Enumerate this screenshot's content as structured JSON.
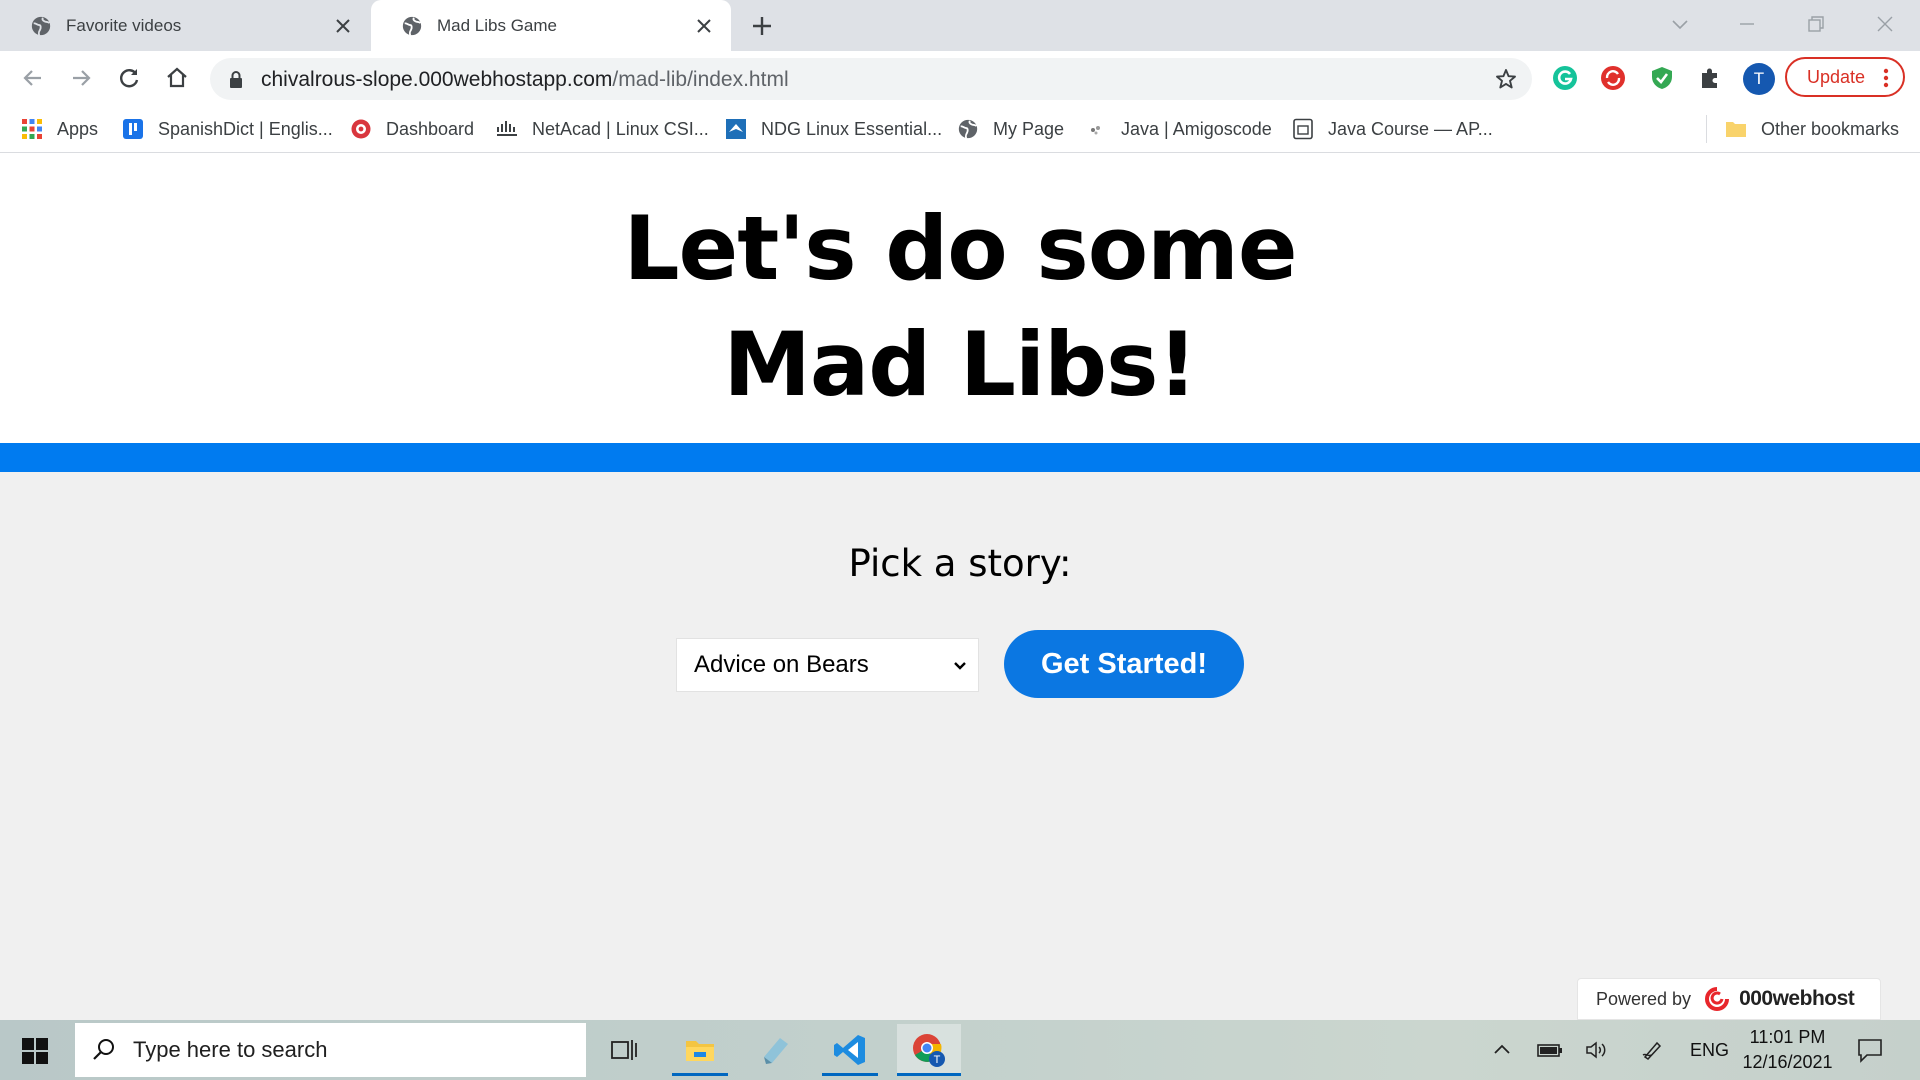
{
  "browser": {
    "tabs": [
      {
        "title": "Favorite videos",
        "active": false
      },
      {
        "title": "Mad Libs Game",
        "active": true
      }
    ],
    "address": {
      "host": "chivalrous-slope.000webhostapp.com",
      "path": "/mad-lib/index.html"
    },
    "profile_initial": "T",
    "update_label": "Update",
    "bookmarks": [
      {
        "label": "Apps",
        "icon": "apps-grid-icon"
      },
      {
        "label": "SpanishDict | Englis...",
        "icon": "spanishdict-icon"
      },
      {
        "label": "Dashboard",
        "icon": "dashboard-icon"
      },
      {
        "label": "NetAcad | Linux CSI...",
        "icon": "cisco-icon"
      },
      {
        "label": "NDG Linux Essential...",
        "icon": "ndg-icon"
      },
      {
        "label": "My Page",
        "icon": "globe-icon"
      },
      {
        "label": "Java | Amigoscode",
        "icon": "amigoscode-icon"
      },
      {
        "label": "Java Course — AP...",
        "icon": "document-icon"
      }
    ],
    "other_bookmarks": "Other bookmarks"
  },
  "page": {
    "headline_line1": "Let's do some",
    "headline_line2": "Mad Libs!",
    "pick_label": "Pick a story:",
    "story_selected": "Advice on Bears",
    "start_button": "Get Started!",
    "powered_by": "Powered by",
    "host_brand": "000webhost"
  },
  "taskbar": {
    "search_placeholder": "Type here to search",
    "language": "ENG",
    "time": "11:01 PM",
    "date": "12/16/2021"
  },
  "colors": {
    "accent_band": "#007bf0",
    "button": "#0b77e2",
    "update_red": "#d93025"
  }
}
